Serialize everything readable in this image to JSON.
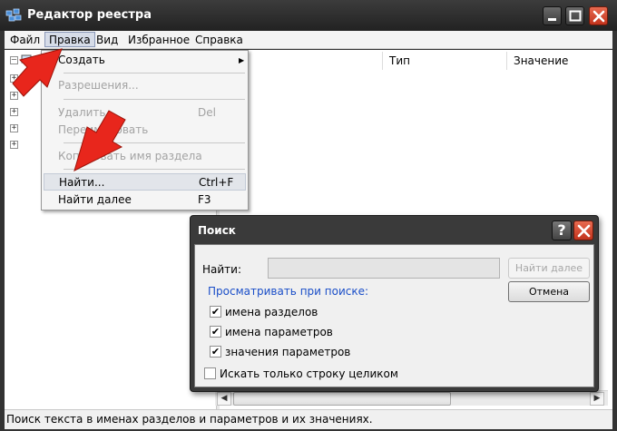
{
  "window": {
    "title": "Редактор реестра",
    "icon": "registry-editor-icon"
  },
  "menubar": {
    "items": [
      "Файл",
      "Правка",
      "Вид",
      "Избранное",
      "Справка"
    ],
    "active": "Правка"
  },
  "tree": {
    "root_expander": "–",
    "child_expander": "+"
  },
  "list": {
    "columns": [
      "",
      "Тип",
      "Значение"
    ]
  },
  "edit_menu": {
    "create": "Создать",
    "permissions": "Разрешения...",
    "delete": "Удалить",
    "delete_shortcut": "Del",
    "rename": "Переименовать",
    "copy_key_name": "Копировать имя раздела",
    "find": "Найти...",
    "find_shortcut": "Ctrl+F",
    "find_next": "Найти далее",
    "find_next_shortcut": "F3"
  },
  "find_dialog": {
    "title": "Поиск",
    "help_glyph": "?",
    "find_label": "Найти:",
    "find_value": "",
    "find_next_button": "Найти далее",
    "cancel_button": "Отмена",
    "look_at_label": "Просматривать при поиске:",
    "options": [
      {
        "label": "имена разделов",
        "checked": true
      },
      {
        "label": "имена параметров",
        "checked": true
      },
      {
        "label": "значения параметров",
        "checked": true
      }
    ],
    "match_whole": {
      "label": "Искать только строку целиком",
      "checked": false
    }
  },
  "statusbar": {
    "text": "Поиск текста в именах разделов и параметров и их значениях."
  },
  "colors": {
    "titlebar": "#2e2e2e",
    "close": "#d2432a",
    "accent_blue": "#1a4ec8",
    "arrow": "#e8261c"
  }
}
